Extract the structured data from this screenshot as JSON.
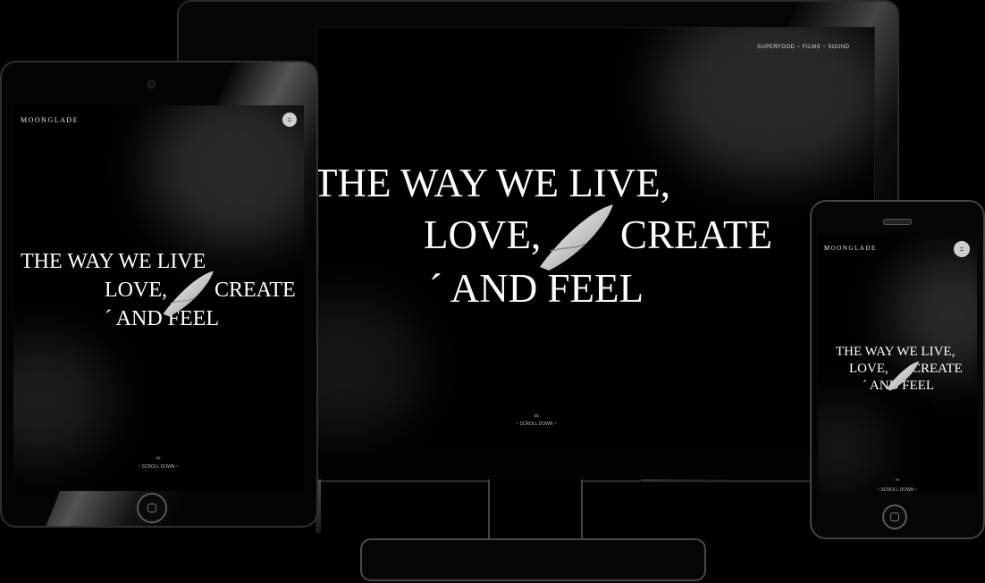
{
  "brand": {
    "logo": "MOONGLADE"
  },
  "desktop": {
    "nav": {
      "item1": "SUPERFOOD",
      "sep1": "~",
      "item2": "FILMS",
      "sep2": "~",
      "item3": "SOUND"
    },
    "headline": {
      "line1": "THE WAY WE LIVE,",
      "line2a": "LOVE,",
      "line2b": "CREATE",
      "line3": "´ AND FEEL"
    },
    "scroll": {
      "icon": "∞",
      "label": "~ SCROLL DOWN ~"
    }
  },
  "tablet": {
    "headline": {
      "line1": "THE WAY WE LIVE",
      "line2a": "LOVE,",
      "line2b": "CREATE",
      "line3": "´ AND FEEL"
    },
    "menu_icon": "=",
    "scroll": {
      "icon": "∞",
      "label": "~ SCROLL DOWN ~"
    }
  },
  "phone": {
    "headline": {
      "line1": "THE WAY WE LIVE,",
      "line2a": "LOVE,",
      "line2b": "CREATE",
      "line3": "´ AND FEEL"
    },
    "menu_icon": "=",
    "scroll": {
      "icon": "∞",
      "label": "~ SCROLL DOWN ~"
    }
  },
  "icons": {
    "menu": "hamburger-menu-icon",
    "scroll": "infinity-icon",
    "surfboard": "surfboard-image",
    "home": "home-button-icon"
  },
  "colors": {
    "background": "#000000",
    "text": "#ffffff",
    "menu_button": "#cfcfcf"
  }
}
